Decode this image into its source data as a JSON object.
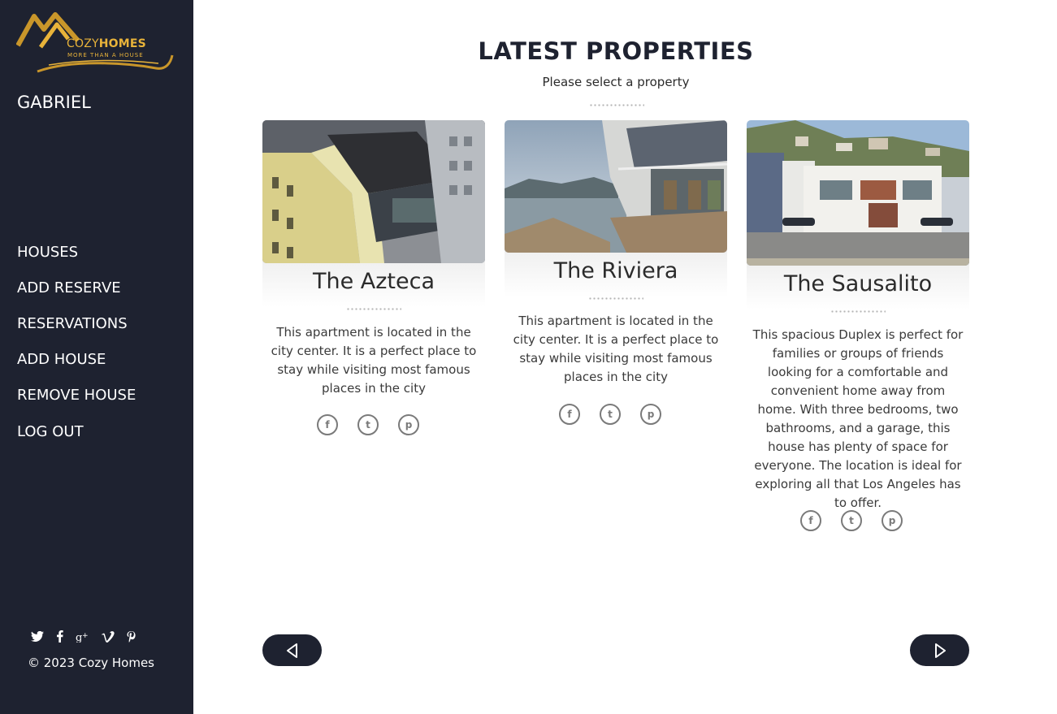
{
  "sidebar": {
    "logo": {
      "brand_light": "COZY",
      "brand_bold": "HOMES",
      "tagline": "MORE THAN A HOUSE"
    },
    "username": "GABRIEL",
    "nav": [
      "HOUSES",
      "ADD RESERVE",
      "RESERVATIONS",
      "ADD HOUSE",
      "REMOVE HOUSE",
      "LOG OUT"
    ],
    "social_icons": [
      "twitter-icon",
      "facebook-icon",
      "google-plus-icon",
      "vimeo-icon",
      "pinterest-icon"
    ],
    "copyright": "© 2023 Cozy Homes"
  },
  "main": {
    "title": "LATEST PROPERTIES",
    "subtitle": "Please select a property"
  },
  "properties": [
    {
      "name": "The Azteca",
      "description": "This apartment is located in the city center. It is a perfect place to stay while visiting most famous places in the city",
      "icons": [
        "facebook-icon",
        "twitter-icon",
        "pinterest-icon"
      ]
    },
    {
      "name": "The Riviera",
      "description": "This apartment is located in the city center. It is a perfect place to stay while visiting most famous places in the city",
      "icons": [
        "facebook-icon",
        "twitter-icon",
        "pinterest-icon"
      ]
    },
    {
      "name": "The Sausalito",
      "description": "This spacious Duplex is perfect for families or groups of friends looking for a comfortable and convenient home away from home. With three bedrooms, two bathrooms, and a garage, this house has plenty of space for everyone. The location is ideal for exploring all that Los Angeles has to offer.",
      "icons": [
        "facebook-icon",
        "twitter-icon",
        "pinterest-icon"
      ]
    }
  ],
  "carousel": {
    "prev_icon": "triangle-left-icon",
    "next_icon": "triangle-right-icon"
  },
  "colors": {
    "sidebar_bg": "#1e2230",
    "accent_gold": "#e8b33a",
    "button_bg": "#1e2230"
  }
}
